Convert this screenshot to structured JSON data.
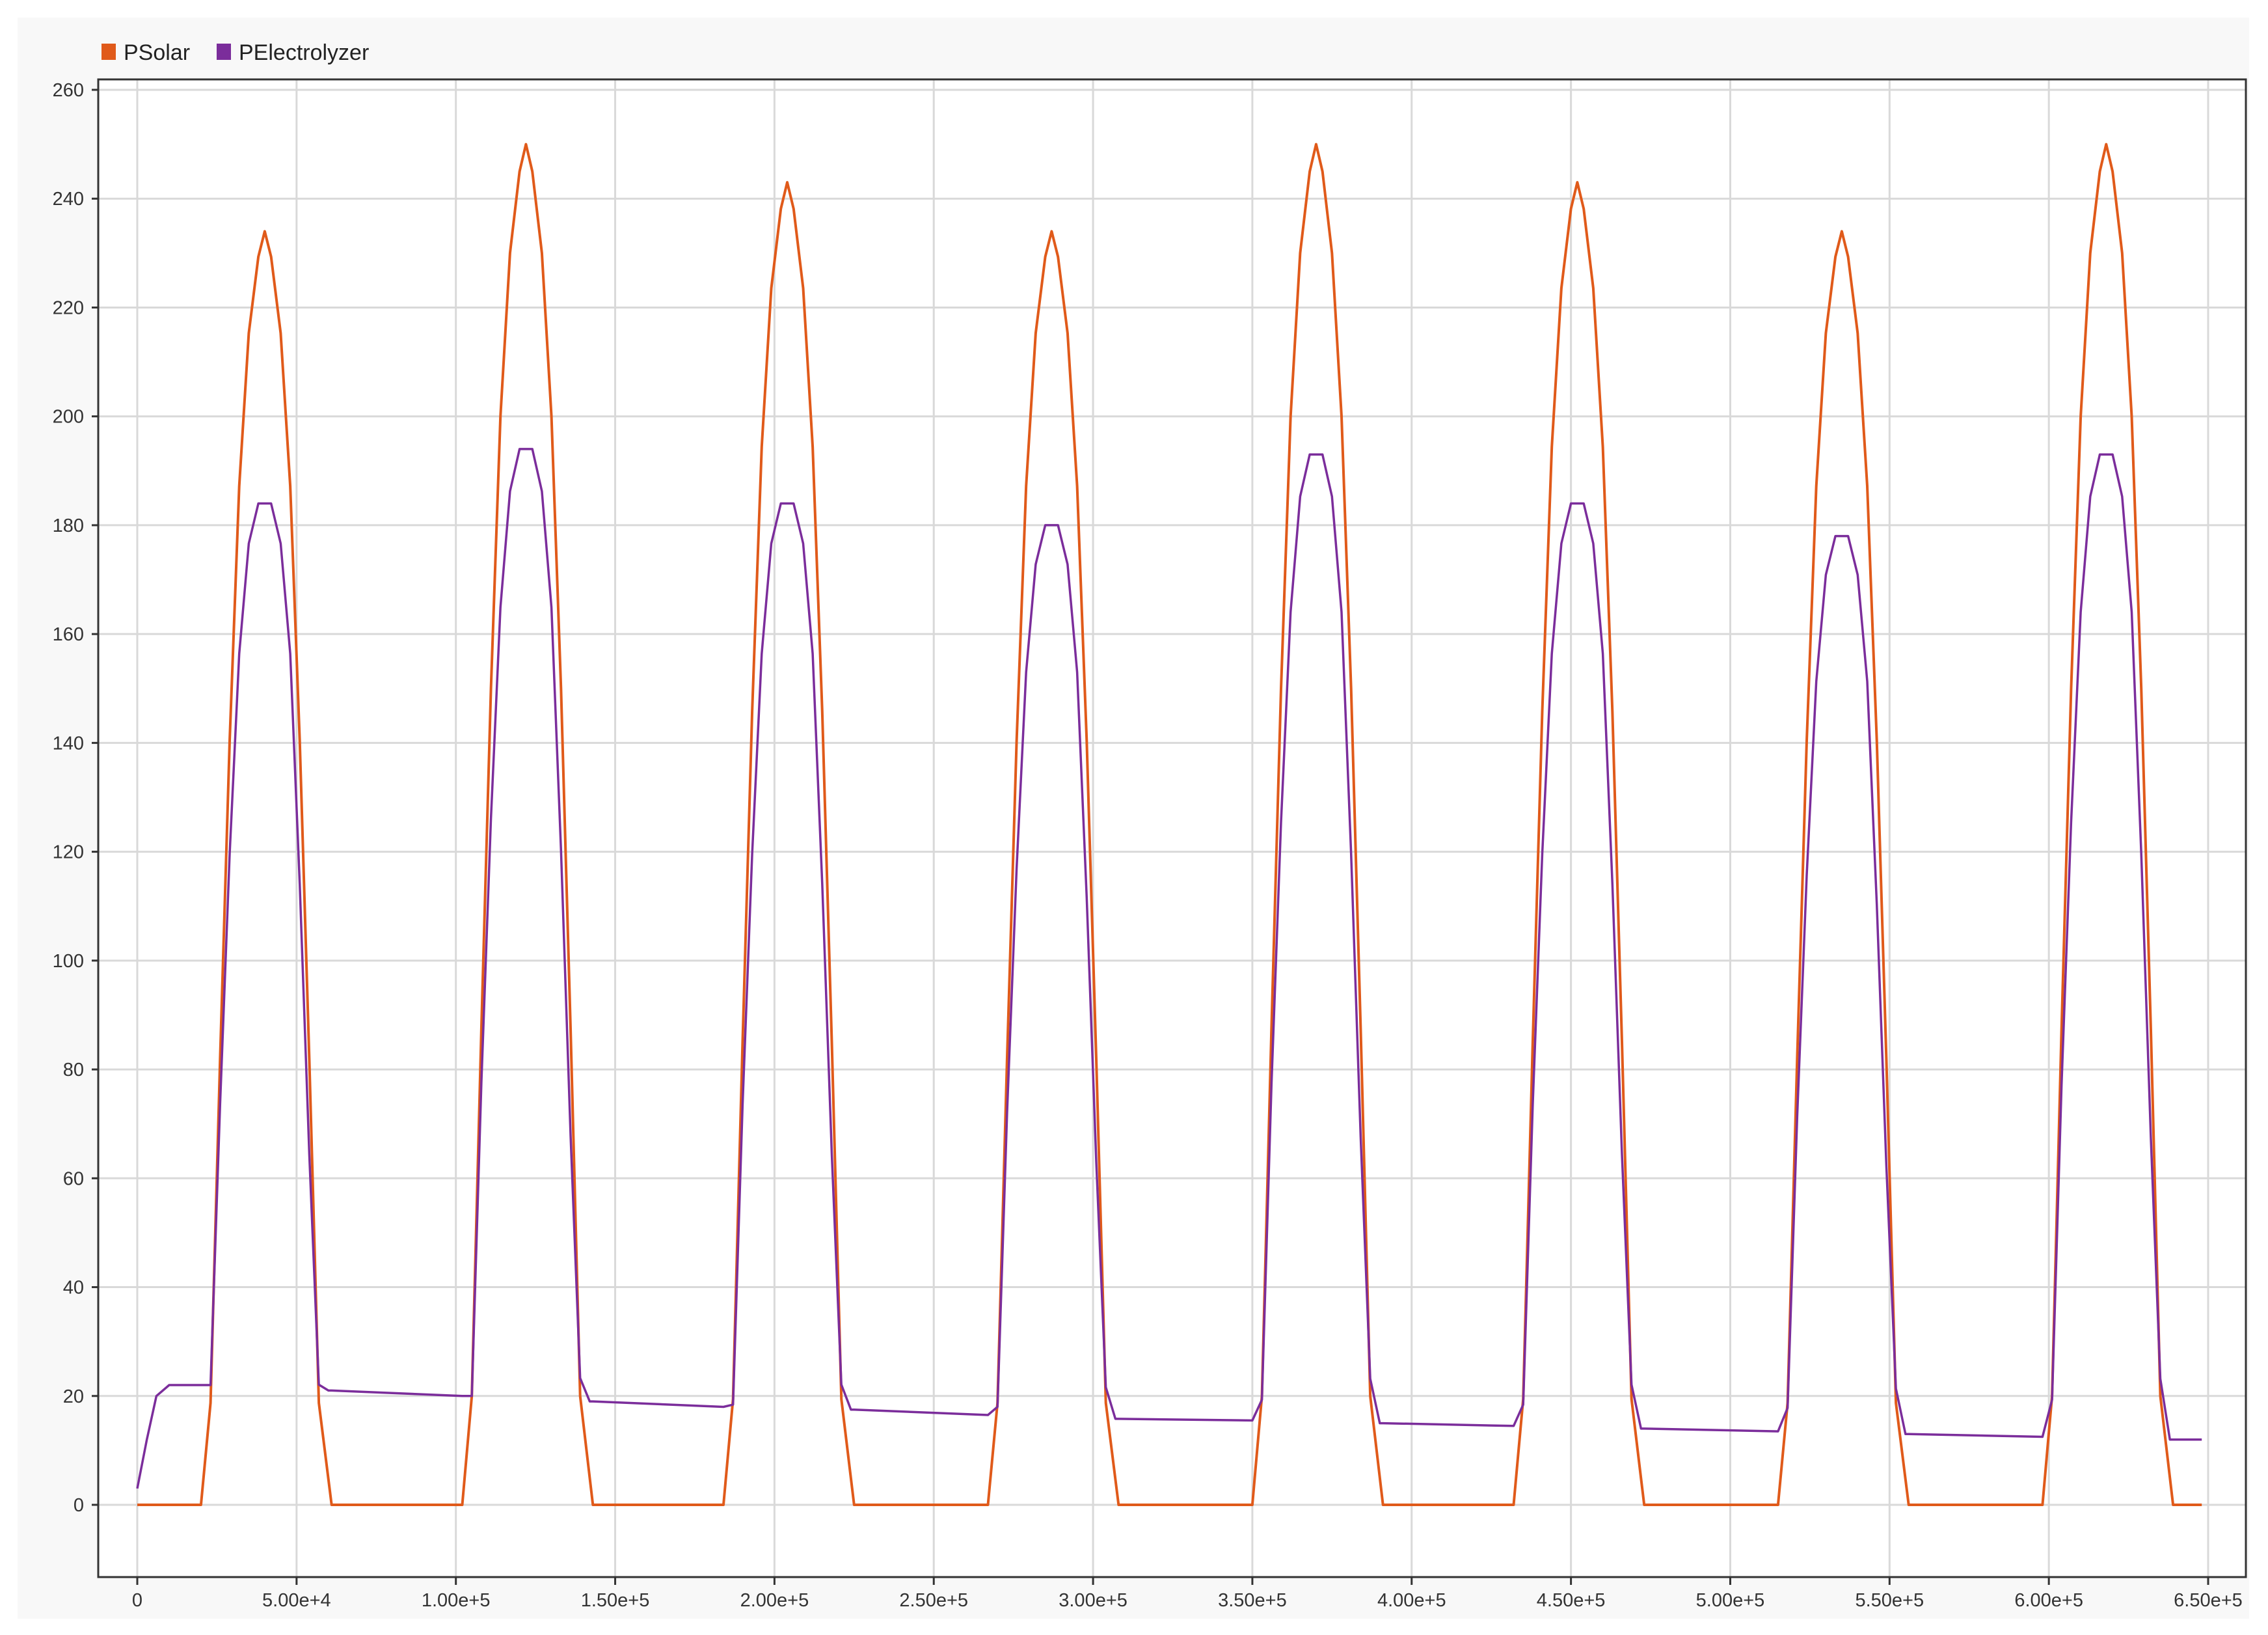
{
  "chart_data": {
    "type": "line",
    "title": "",
    "xlabel": "",
    "ylabel": "",
    "xlim": [
      -12500,
      665000
    ],
    "ylim": [
      -13.3,
      262
    ],
    "grid": true,
    "legend_placement": "top-left",
    "x_ticks": [
      0,
      50000,
      100000,
      150000,
      200000,
      250000,
      300000,
      350000,
      400000,
      450000,
      500000,
      550000,
      600000,
      650000
    ],
    "x_tick_labels": [
      "0",
      "5.00e+4",
      "1.00e+5",
      "1.50e+5",
      "2.00e+5",
      "2.50e+5",
      "3.00e+5",
      "3.50e+5",
      "4.00e+5",
      "4.50e+5",
      "5.00e+5",
      "5.50e+5",
      "6.00e+5",
      "6.50e+5"
    ],
    "y_ticks": [
      0,
      20,
      40,
      60,
      80,
      100,
      120,
      140,
      160,
      180,
      200,
      220,
      240,
      260
    ],
    "y_tick_labels": [
      "0",
      "20",
      "40",
      "60",
      "80",
      "100",
      "120",
      "140",
      "160",
      "180",
      "200",
      "220",
      "240",
      "260"
    ],
    "profile_offsets": [
      -20000,
      -17000,
      -14000,
      -11000,
      -8000,
      -5000,
      -2000,
      0,
      2000,
      5000,
      8000,
      11000,
      14000,
      17000,
      20000,
      21000
    ],
    "series": [
      {
        "name": "PSolar",
        "color": "#e05a1a",
        "profile_fractions": [
          0,
          0.08,
          0.35,
          0.6,
          0.8,
          0.92,
          0.98,
          1,
          0.98,
          0.92,
          0.8,
          0.6,
          0.35,
          0.08,
          0.02,
          0
        ],
        "day_centers": [
          40000,
          122000,
          204000,
          287000,
          370000,
          452000,
          535000,
          618000
        ],
        "day_peaks": [
          234,
          250,
          243,
          234,
          250,
          243,
          234,
          250
        ],
        "x_end": 648000,
        "baseline": 0
      },
      {
        "name": "PElectrolyzer",
        "color": "#7b2d9b",
        "profile_fractions": [
          0,
          0.1,
          0.4,
          0.65,
          0.85,
          0.96,
          1,
          1,
          1,
          0.96,
          0.85,
          0.62,
          0.35,
          0.12,
          0,
          0
        ],
        "day_centers": [
          40000,
          122000,
          204000,
          287000,
          370000,
          452000,
          535000,
          618000
        ],
        "day_peaks": [
          184,
          194,
          184,
          180,
          193,
          184,
          178,
          193
        ],
        "x_end": 648000,
        "initial_ramp": [
          [
            0,
            3
          ],
          [
            3000,
            12
          ],
          [
            6000,
            20
          ],
          [
            10000,
            22
          ]
        ],
        "baseline_segments": [
          [
            22,
            22
          ],
          [
            21,
            20
          ],
          [
            19,
            18
          ],
          [
            17.5,
            16.5
          ],
          [
            15.8,
            15.5
          ],
          [
            15,
            14.5
          ],
          [
            14,
            13.5
          ],
          [
            13,
            12.5
          ],
          [
            12,
            12
          ]
        ]
      }
    ]
  }
}
